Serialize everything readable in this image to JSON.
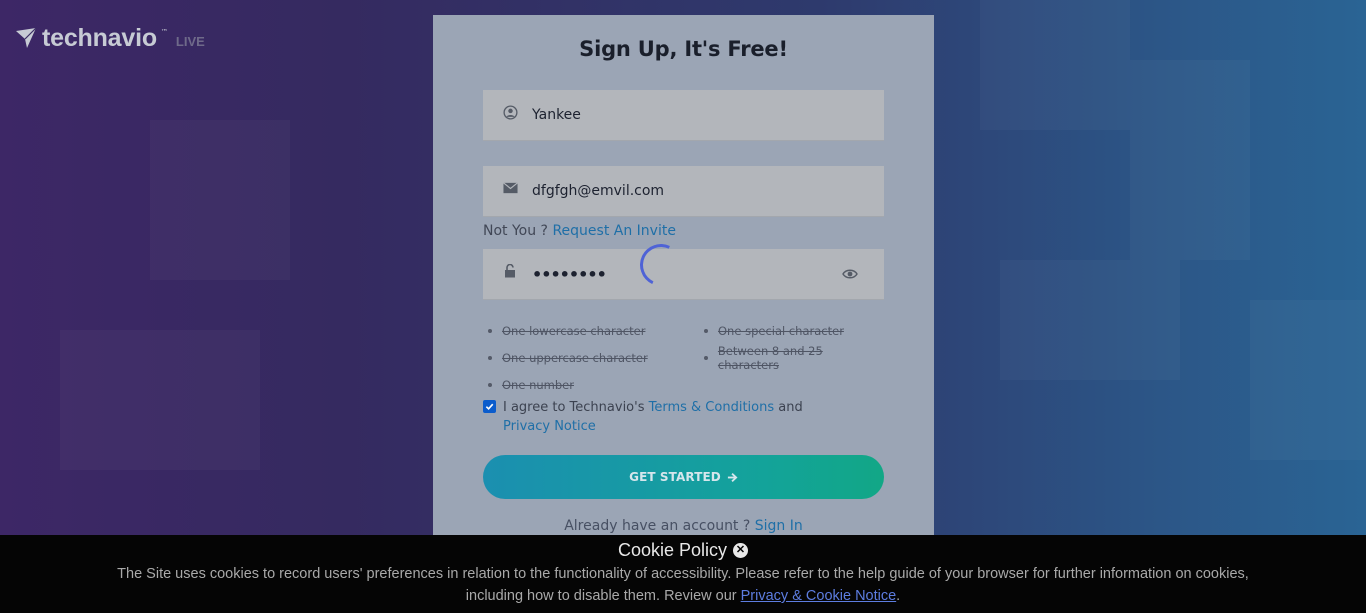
{
  "brand": {
    "name": "technavio",
    "suffix": "LIVE"
  },
  "signup": {
    "title": "Sign Up, It's Free!",
    "name_value": "Yankee",
    "email_value": "dfgfgh@emvil.com",
    "password_masked": "••••••••",
    "not_you_text": "Not You ?",
    "request_invite_label": "Request An Invite",
    "requirements": [
      "One lowercase character",
      "One uppercase character",
      "One number",
      "One special character",
      "Between 8 and 25 characters"
    ],
    "agree_prefix": "I agree to Technavio's",
    "terms_label": "Terms & Conditions",
    "agree_and": "and",
    "privacy_label": "Privacy Notice",
    "agree_checked": true,
    "submit_label": "GET STARTED",
    "already_text": "Already have an account ?",
    "sign_in_label": "Sign In"
  },
  "cookie": {
    "title": "Cookie Policy",
    "message": "The Site uses cookies to record users' preferences in relation to the functionality of accessibility. Please refer to the help guide of your browser for further information on cookies, including how to disable them. Review our",
    "link_label": "Privacy & Cookie Notice",
    "end": "."
  },
  "icons": {
    "user": "user-circle-icon",
    "email": "envelope-icon",
    "lock": "unlock-icon",
    "eye": "eye-icon",
    "arrow": "arrow-right-icon",
    "close": "close-circle-icon",
    "logo": "paper-plane-logo-icon"
  },
  "colors": {
    "accent_link": "#1f6fa7",
    "button_start": "#1b8fb0",
    "button_end": "#12a786",
    "spinner": "#4f63d6"
  }
}
